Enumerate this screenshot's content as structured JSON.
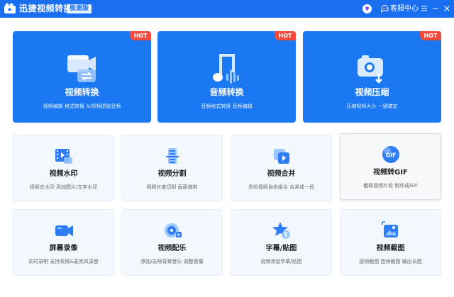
{
  "window": {
    "title": "迅捷视频转换器",
    "edition": "极速版",
    "service_label": "客服中心"
  },
  "colors": {
    "primary": "#1a6ef0",
    "card_blue": "#1a78f2",
    "hot_red": "#f5493d",
    "tile_bg": "#f3f8fe"
  },
  "big_cards": [
    {
      "name": "视频转换",
      "desc": "视频编辑 格式转换 从视频提取音频",
      "badge": "HOT",
      "icon": "video-convert-icon"
    },
    {
      "name": "音频转换",
      "desc": "音频格式转换 音频编辑",
      "badge": "HOT",
      "icon": "music-note-icon"
    },
    {
      "name": "视频压缩",
      "desc": "压缩视频大小 一键搞定",
      "badge": "HOT",
      "icon": "camera-compress-icon"
    }
  ],
  "tools": [
    {
      "name": "视频水印",
      "desc": "视频去水印 添加图片/文字水印",
      "icon": "film-watermark-icon"
    },
    {
      "name": "视频分割",
      "desc": "视频长度切割 画面裁剪",
      "icon": "split-icon"
    },
    {
      "name": "视频合并",
      "desc": "多段视频自由组合 合并成一段",
      "icon": "merge-icon"
    },
    {
      "name": "视频转GIF",
      "desc": "截取视频片段 制作成GIF",
      "icon": "gif-icon",
      "gif_text": "GIF"
    },
    {
      "name": "屏幕录像",
      "desc": "实时录制 支持系统&麦克风录音",
      "icon": "screen-record-icon"
    },
    {
      "name": "视频配乐",
      "desc": "添加/去除背景音乐 调整音量",
      "icon": "music-disc-icon"
    },
    {
      "name": "字幕/贴图",
      "desc": "视频添加字幕/贴图",
      "icon": "star-sticker-icon",
      "badge_letter": "T"
    },
    {
      "name": "视频截图",
      "desc": "逐帧截图 连续截图 输出长图",
      "icon": "image-capture-icon"
    }
  ]
}
